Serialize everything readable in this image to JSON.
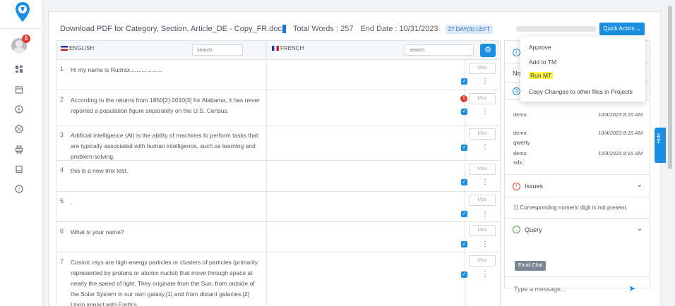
{
  "header": {
    "doc_title": "Download PDF for Category, Section, Article_DE - Copy_FR.doc",
    "words_label": "Total Words : ",
    "words_value": "257",
    "end_label": "End Date : ",
    "end_value": "10/31/2023",
    "days_left": "27 DAY(S) LEFT"
  },
  "sidebar": {
    "notification_count": "0"
  },
  "columns": {
    "source_lang": "ENGLISH",
    "target_lang": "FRENCH",
    "source_search_placeholder": "search",
    "target_search_placeholder": "search"
  },
  "max_placeholder": "Max",
  "segments": [
    {
      "num": "1",
      "text": "HI my name is Rudrax..................."
    },
    {
      "num": "2",
      "text": "According to the returns from 1850[2]-2010[3] for Alabama, it has never reported a population figure separately on the U.S. Census."
    },
    {
      "num": "3",
      "text": "Artificial intelligence (AI) is the ability of machines to perform tasks that are typically associated with human intelligence, such as learning and problem-solving."
    },
    {
      "num": "4",
      "text": "this is a new tmx test."
    },
    {
      "num": "5",
      "text": "."
    },
    {
      "num": "6",
      "text": "What is your name?"
    },
    {
      "num": "7",
      "text": "Cosmic rays are high-energy particles or clusters of particles (primarily represented by protons or atomic nuclei) that move through space at nearly the speed of light. They originate from the Sun, from outside of the Solar System in our own galaxy,[1] and from distant galaxies.[2] Upon impact with Earth's"
    }
  ],
  "quick_action": {
    "label": "Quick Action",
    "items": [
      "Approve",
      "Add to TM",
      "Run MT",
      "Copy Changes to other files in Projects"
    ]
  },
  "panel": {
    "partial_label": "No",
    "history": [
      {
        "user": "demo",
        "date": "10/4/2023 8:16 AM",
        "note": ""
      },
      {
        "user": "demo",
        "date": "10/4/2023 8:16 AM",
        "note": "qwerty"
      },
      {
        "user": "demo",
        "date": "10/4/2023 8:16 AM",
        "note": "sdx"
      }
    ],
    "issues_title": "Issues",
    "issues_text": "1) Corresponding numeric digit is not present.",
    "query_title": "Query",
    "email_chat": "Email Chat",
    "message_placeholder": "Type a message...",
    "hide_label": "Hide"
  },
  "colors": {
    "accent": "#1a8ee0",
    "warn": "#e5392b",
    "highlight": "#fbf54a"
  }
}
